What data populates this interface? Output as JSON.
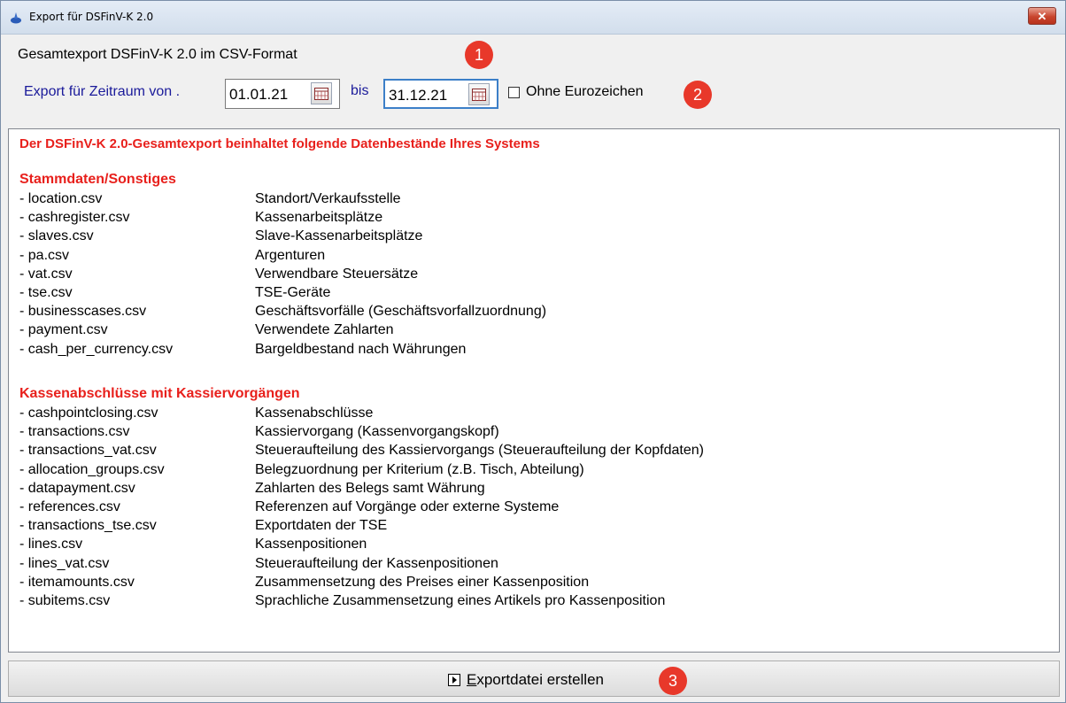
{
  "window": {
    "title": "Export für DSFinV-K 2.0",
    "close_label": "✕"
  },
  "heading": "Gesamtexport DSFinV-K 2.0 im CSV-Format",
  "period": {
    "label": "Export für Zeitraum von .",
    "from": "01.01.21",
    "bis_label": "bis",
    "to": "31.12.21"
  },
  "option": {
    "label": "Ohne Eurozeichen",
    "checked": false
  },
  "markers": [
    "1",
    "2",
    "3"
  ],
  "info": {
    "title": "Der DSFinV-K 2.0-Gesamtexport beinhaltet folgende Datenbestände Ihres Systems",
    "sections": [
      {
        "title": "Stammdaten/Sonstiges",
        "rows": [
          {
            "file": "- location.csv",
            "desc": "Standort/Verkaufsstelle"
          },
          {
            "file": "- cashregister.csv",
            "desc": "Kassenarbeitsplätze"
          },
          {
            "file": "- slaves.csv",
            "desc": "Slave-Kassenarbeitsplätze"
          },
          {
            "file": "- pa.csv",
            "desc": "Argenturen"
          },
          {
            "file": "- vat.csv",
            "desc": "Verwendbare Steuersätze"
          },
          {
            "file": "- tse.csv",
            "desc": "TSE-Geräte"
          },
          {
            "file": "- businesscases.csv",
            "desc": "Geschäftsvorfälle (Geschäftsvorfallzuordnung)"
          },
          {
            "file": "- payment.csv",
            "desc": "Verwendete Zahlarten"
          },
          {
            "file": "- cash_per_currency.csv",
            "desc": "Bargeldbestand nach Währungen"
          }
        ]
      },
      {
        "title": "Kassenabschlüsse mit Kassiervorgängen",
        "rows": [
          {
            "file": "- cashpointclosing.csv",
            "desc": "Kassenabschlüsse"
          },
          {
            "file": "- transactions.csv",
            "desc": "Kassiervorgang (Kassenvorgangskopf)"
          },
          {
            "file": "- transactions_vat.csv",
            "desc": "Steueraufteilung des Kassiervorgangs (Steueraufteilung der Kopfdaten)"
          },
          {
            "file": "- allocation_groups.csv",
            "desc": "Belegzuordnung per Kriterium (z.B. Tisch, Abteilung)"
          },
          {
            "file": "- datapayment.csv",
            "desc": "Zahlarten des Belegs samt Währung"
          },
          {
            "file": "- references.csv",
            "desc": "Referenzen auf Vorgänge oder externe Systeme"
          },
          {
            "file": "- transactions_tse.csv",
            "desc": "Exportdaten der TSE"
          },
          {
            "file": "- lines.csv",
            "desc": "Kassenpositionen"
          },
          {
            "file": "- lines_vat.csv",
            "desc": "Steueraufteilung der Kassenpositionen"
          },
          {
            "file": "- itemamounts.csv",
            "desc": "Zusammensetzung des Preises einer Kassenposition"
          },
          {
            "file": "- subitems.csv",
            "desc": "Sprachliche Zusammensetzung eines Artikels pro Kassenposition"
          }
        ]
      }
    ]
  },
  "export_button": {
    "mnemonic": "E",
    "label_rest": "xportdatei erstellen"
  },
  "colors": {
    "heading_red": "#e8201c",
    "label_blue": "#1a1a9a",
    "marker_red": "#e8382a"
  }
}
